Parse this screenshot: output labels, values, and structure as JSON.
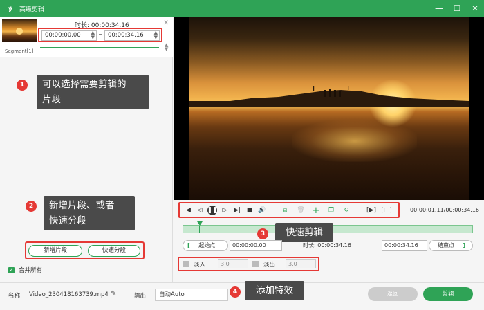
{
  "window": {
    "title": "高级剪辑",
    "logo_glyph": "ꝟ",
    "minimize_glyph": "—",
    "maximize_glyph": "☐",
    "close_glyph": "✕"
  },
  "segment": {
    "duration_label": "时长:",
    "duration_value": "00:00:34.16",
    "start_time": "00:00:00.00",
    "end_time": "00:00:34.16",
    "name": "Segment[1]"
  },
  "callouts": {
    "c1": {
      "number": "1",
      "text_line1": "可以选择需要剪辑的",
      "text_line2": "片段"
    },
    "c2": {
      "number": "2",
      "text_line1": "新增片段、或者",
      "text_line2": "快速分段"
    },
    "c3": {
      "number": "3",
      "text": "快速剪辑"
    },
    "c4": {
      "number": "4",
      "text": "添加特效"
    }
  },
  "buttons": {
    "add_segment": "新增片段",
    "quick_split": "快速分段",
    "merge_all": "合并所有",
    "back": "返回",
    "edit": "剪辑"
  },
  "player": {
    "current_time": "00:00:01.11/00:00:34.16"
  },
  "trim": {
    "start_label": "起始点",
    "start_value": "00:00:00.00",
    "duration_label": "时长:",
    "duration_value": "00:00:34.16",
    "end_value": "00:00:34.16",
    "end_label": "结束点"
  },
  "effects": {
    "fade_in_label": "淡入",
    "fade_in_value": "3.0",
    "fade_out_label": "淡出",
    "fade_out_value": "3.0"
  },
  "bottom": {
    "name_label": "名称:",
    "name_value": "Video_230418163739.mp4",
    "output_label": "输出:",
    "output_value": "自动Auto"
  },
  "colors": {
    "accent": "#2fa356",
    "highlight": "#e53935",
    "callout_bg": "#4a4a4a"
  }
}
